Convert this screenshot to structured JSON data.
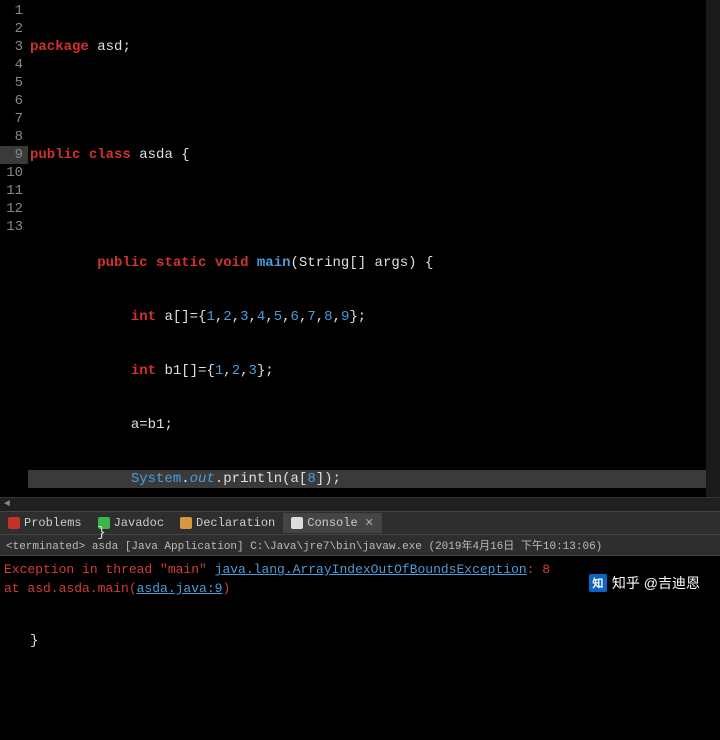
{
  "gutter": [
    "1",
    "2",
    "3",
    "4",
    "5",
    "6",
    "7",
    "8",
    "9",
    "10",
    "11",
    "12",
    "13"
  ],
  "code": {
    "l1": {
      "kw": "package",
      "sp": " ",
      "name": "asd",
      "semi": ";"
    },
    "l3": {
      "kw1": "public",
      "sp1": " ",
      "kw2": "class",
      "sp2": " ",
      "name": "asda",
      "sp3": " ",
      "brace": "{"
    },
    "l5": {
      "indent": "        ",
      "kw1": "public",
      "sp1": " ",
      "kw2": "static",
      "sp2": " ",
      "kw3": "void",
      "sp3": " ",
      "mth": "main",
      "paren": "(",
      "type": "String",
      "arr": "[] ",
      "arg": "args",
      "close": ") {"
    },
    "l6": {
      "indent": "            ",
      "type": "int",
      "sp": " ",
      "var": "a",
      "arr": "[]={",
      "n1": "1",
      "c1": ",",
      "n2": "2",
      "c2": ",",
      "n3": "3",
      "c3": ",",
      "n4": "4",
      "c4": ",",
      "n5": "5",
      "c5": ",",
      "n6": "6",
      "c6": ",",
      "n7": "7",
      "c7": ",",
      "n8": "8",
      "c8": ",",
      "n9": "9",
      "end": "};"
    },
    "l7": {
      "indent": "            ",
      "type": "int",
      "sp": " ",
      "var": "b1",
      "arr": "[]={",
      "n1": "1",
      "c1": ",",
      "n2": "2",
      "c2": ",",
      "n3": "3",
      "end": "};"
    },
    "l8": {
      "indent": "            ",
      "var": "a=b1",
      "semi": ";"
    },
    "l9": {
      "indent": "            ",
      "sys": "System",
      "dot1": ".",
      "out": "out",
      "dot2": ".",
      "prn": "println",
      "paren": "(",
      "var": "a",
      "br": "[",
      "idx": "8",
      "close": "]);"
    },
    "l10": {
      "indent": "        ",
      "brace": "}"
    },
    "l12": {
      "brace": "}"
    }
  },
  "tabs": {
    "problems": "Problems",
    "javadoc": "Javadoc",
    "declaration": "Declaration",
    "console": "Console"
  },
  "terminated": "<terminated> asda [Java Application] C:\\Java\\jre7\\bin\\javaw.exe (2019年4月16日 下午10:13:06)",
  "console": {
    "l1a": "Exception in thread \"main\" ",
    "l1b": "java.lang.ArrayIndexOutOfBoundsException",
    "l1c": ": 8",
    "l2a": "        at asd.asda.main(",
    "l2b": "asda.java:9",
    "l2c": ")"
  },
  "watermark": {
    "logo": "知",
    "text": "知乎 @吉迪恩"
  }
}
